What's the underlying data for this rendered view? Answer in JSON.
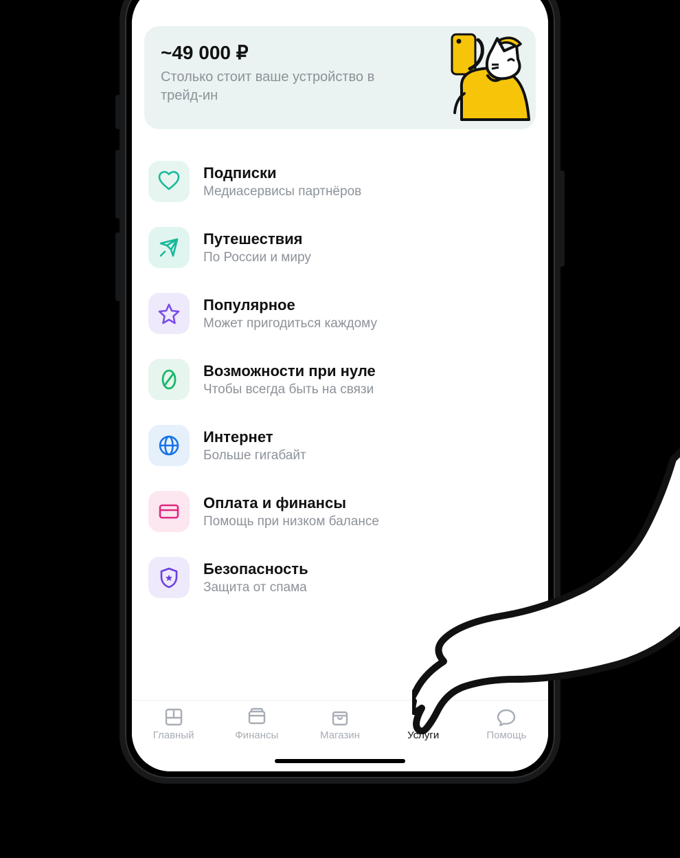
{
  "banner": {
    "title": "~49 000 ₽",
    "subtitle": "Столько стоит ваше устройство в трейд-ин"
  },
  "items": [
    {
      "icon": "heart",
      "bg": "bg-mint",
      "title": "Подписки",
      "sub": "Медиасервисы партнёров"
    },
    {
      "icon": "plane",
      "bg": "bg-teal",
      "title": "Путешествия",
      "sub": "По России и миру"
    },
    {
      "icon": "star",
      "bg": "bg-purple",
      "title": "Популярное",
      "sub": "Может пригодиться каждому"
    },
    {
      "icon": "zero",
      "bg": "bg-green",
      "title": "Возможности при нуле",
      "sub": "Чтобы всегда быть на связи"
    },
    {
      "icon": "globe",
      "bg": "bg-blue",
      "title": "Интернет",
      "sub": "Больше гигабайт"
    },
    {
      "icon": "card",
      "bg": "bg-pink",
      "title": "Оплата и финансы",
      "sub": "Помощь при низком балансе"
    },
    {
      "icon": "shield",
      "bg": "bg-violet",
      "title": "Безопасность",
      "sub": "Защита от спама"
    }
  ],
  "nav": {
    "items": [
      {
        "id": "home",
        "label": "Главный",
        "icon": "grid"
      },
      {
        "id": "finance",
        "label": "Финансы",
        "icon": "wallet"
      },
      {
        "id": "shop",
        "label": "Магазин",
        "icon": "bag"
      },
      {
        "id": "services",
        "label": "Услуги",
        "icon": "layers",
        "active": true
      },
      {
        "id": "help",
        "label": "Помощь",
        "icon": "chat"
      }
    ]
  }
}
